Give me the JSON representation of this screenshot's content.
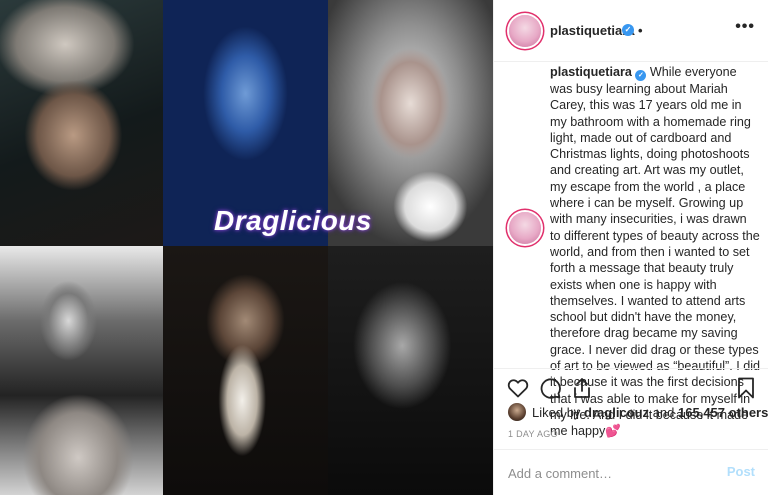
{
  "watermark": "Draglicious",
  "header": {
    "username": "plastiquetiara",
    "verified_mark": "✓",
    "separator": "•",
    "more": "•••"
  },
  "caption": {
    "username": "plastiquetiara",
    "verified_mark": "✓",
    "text": "While everyone was busy learning about Mariah Carey, this was 17 years old me in my bathroom with a homemade ring light, made out of cardboard and Christmas lights, doing photoshoots and creating art. Art was my outlet, my escape from the world , a place where i can be myself. Growing up with many insecurities, i was drawn to different types of beauty across the world, and from then i wanted to set forth a message that beauty truly exists when one is happy with themselves. I wanted to attend arts school but didn't have the money, therefore drag became my saving grace. I never did drag or these types of art to be viewed as “beautiful”. I did it because it was the first decisions that i was able to make for myself in my life. And I did it because it made me happy",
    "emoji": "💕"
  },
  "likes": {
    "prefix": "Liked by",
    "user": "draglicouz",
    "connector": "and",
    "count": "165,457 others"
  },
  "timestamp": "1 DAY AGO",
  "comment": {
    "placeholder": "Add a comment…",
    "post_label": "Post"
  },
  "icons": [
    "heart-icon",
    "comment-icon",
    "share-icon",
    "bookmark-icon"
  ]
}
